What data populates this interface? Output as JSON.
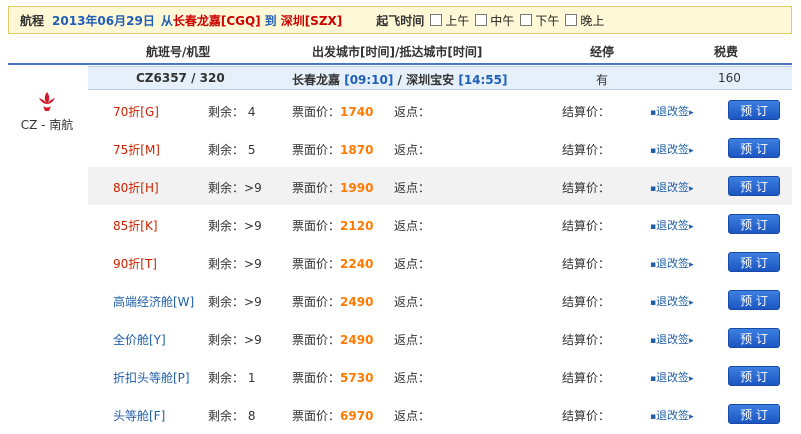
{
  "search": {
    "label": "航程",
    "date": "2013年06月29日",
    "from_prefix": "从",
    "from_city": "长春龙嘉[CGQ]",
    "to_prefix": "到",
    "to_city": "深圳[SZX]",
    "dep_time_label": "起飞时间",
    "time_options": [
      "上午",
      "中午",
      "下午",
      "晚上"
    ]
  },
  "columns": {
    "flight": "航班号/机型",
    "route": "出发城市[时间]/抵达城市[时间]",
    "stops": "经停",
    "tax": "税费"
  },
  "airline": {
    "name": "CZ - 南航",
    "logo_icon": "china-southern-logo-icon"
  },
  "flight": {
    "number": "CZ6357 / 320",
    "dep_city": "长春龙嘉",
    "dep_time": "[09:10]",
    "slash": " / ",
    "arr_city": "深圳宝安",
    "arr_time": "[14:55]",
    "stops": "有",
    "tax": "160"
  },
  "labels": {
    "remaining": "剩余：",
    "face_price": "票面价：",
    "rebate": "返点：",
    "settle": "结算价：",
    "change": "退改签",
    "book": "预 订"
  },
  "fares": [
    {
      "cls": "70折[G]",
      "remain": "4",
      "price": "1740"
    },
    {
      "cls": "75折[M]",
      "remain": "5",
      "price": "1870"
    },
    {
      "cls": "80折[H]",
      "remain": ">9",
      "price": "1990"
    },
    {
      "cls": "85折[K]",
      "remain": ">9",
      "price": "2120"
    },
    {
      "cls": "90折[T]",
      "remain": ">9",
      "price": "2240"
    },
    {
      "cls": "高端经济舱[W]",
      "remain": ">9",
      "price": "2490"
    },
    {
      "cls": "全价舱[Y]",
      "remain": ">9",
      "price": "2490"
    },
    {
      "cls": "折扣头等舱[P]",
      "remain": "1",
      "price": "5730"
    },
    {
      "cls": "头等舱[F]",
      "remain": "8",
      "price": "6970"
    }
  ]
}
